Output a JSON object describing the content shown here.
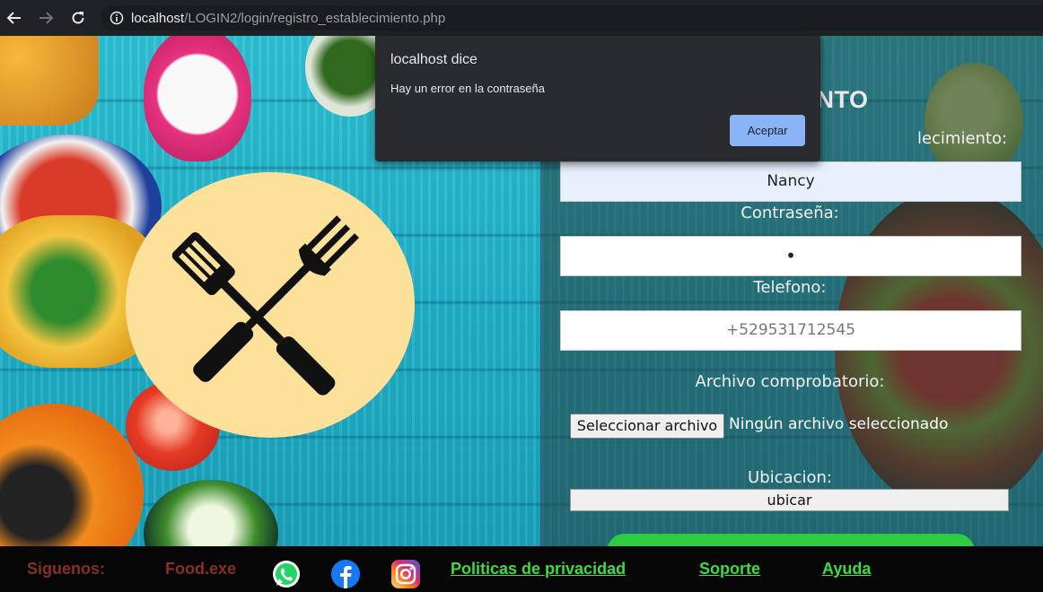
{
  "browser": {
    "url_host": "localhost",
    "url_path": "/LOGIN2/login/registro_establecimiento.php"
  },
  "form": {
    "title": "LECIMIENTO",
    "name_label": "lecimiento:",
    "name_value": "Nancy",
    "password_label": "Contraseña:",
    "password_value": "•",
    "phone_label": "Telefono:",
    "phone_placeholder": "+529531712545",
    "file_label": "Archivo comprobatorio:",
    "file_button": "Seleccionar archivo",
    "file_status": "Ningún archivo seleccionado",
    "location_label": "Ubicacion:",
    "location_button": "ubicar"
  },
  "footer": {
    "follow": "Siguenos:",
    "brand": "Food.exe",
    "privacy": "Politicas de privacidad",
    "support": "Soporte",
    "help": "Ayuda",
    "social_icons": [
      "whatsapp-icon",
      "facebook-icon",
      "instagram-icon"
    ]
  },
  "dialog": {
    "title": "localhost dice",
    "message": "Hay un error en la contraseña",
    "button": "Aceptar"
  },
  "colors": {
    "accent_link": "#3edc3e",
    "footer_text": "#8b2e24",
    "dialog_button": "#8ab4f8",
    "logo_circle": "#fde09a"
  }
}
